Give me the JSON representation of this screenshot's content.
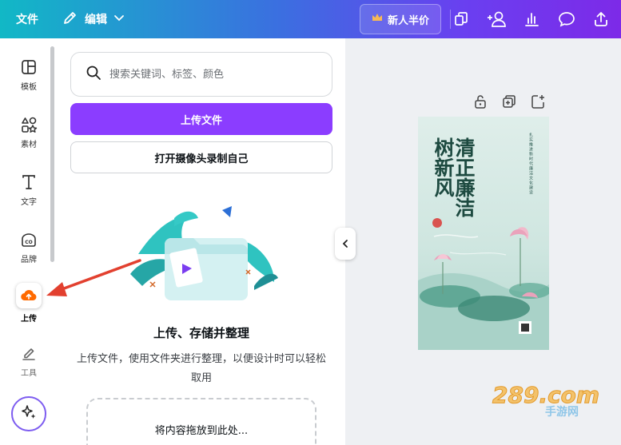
{
  "topbar": {
    "file_label": "文件",
    "edit_label": "编辑",
    "promo_label": "新人半价",
    "icons": [
      "pages-icon",
      "share-people-icon",
      "analytics-icon",
      "comment-icon",
      "upload-export-icon"
    ]
  },
  "rail": {
    "items": [
      {
        "label": "模板",
        "icon": "template-icon"
      },
      {
        "label": "素材",
        "icon": "elements-icon"
      },
      {
        "label": "文字",
        "icon": "text-icon"
      },
      {
        "label": "品牌",
        "icon": "brand-icon"
      },
      {
        "label": "上传",
        "icon": "cloud-upload-icon",
        "active": true
      },
      {
        "label": "工具",
        "icon": "tools-icon"
      }
    ],
    "magic_icon": "sparkle-icon"
  },
  "panel": {
    "search_placeholder": "搜索关键词、标签、颜色",
    "upload_button": "上传文件",
    "camera_button": "打开摄像头录制自己",
    "empty_title": "上传、存储并整理",
    "empty_desc": "上传文件，使用文件夹进行整理，以便设计时可以轻松取用",
    "dropzone_text": "将内容拖放到此处..."
  },
  "canvas": {
    "page_tools": [
      "lock-icon",
      "duplicate-icon",
      "add-page-icon"
    ],
    "poster": {
      "title_right": "清正廉洁",
      "title_left": "树新风",
      "side_text": "扎实推进新时代廉洁文化建设"
    }
  },
  "watermark": {
    "text": "289.com",
    "sub": "手游网"
  },
  "colors": {
    "accent": "#8b3dff",
    "rail_active": "#ff6a00"
  }
}
